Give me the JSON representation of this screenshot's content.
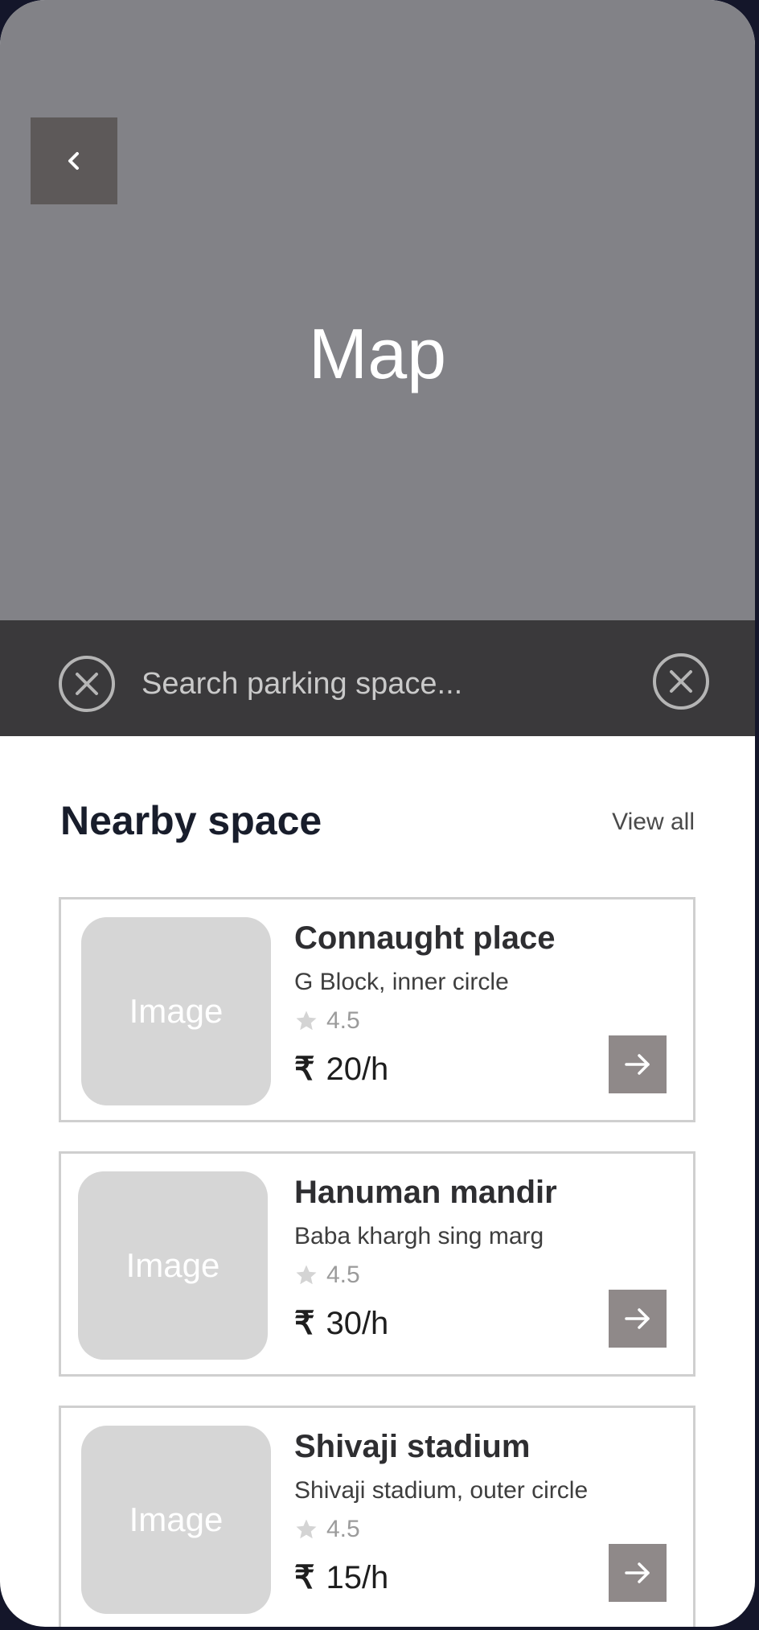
{
  "map": {
    "label": "Map",
    "back_icon": "chevron-left-icon"
  },
  "search": {
    "placeholder": "Search parking space...",
    "left_icon": "close-circle-icon",
    "right_icon": "close-circle-icon"
  },
  "nearby": {
    "title": "Nearby space",
    "view_all_label": "View all",
    "items": [
      {
        "image_label": "Image",
        "name": "Connaught place",
        "address": "G Block, inner circle",
        "rating": "4.5",
        "currency": "₹",
        "price": "20/h"
      },
      {
        "image_label": "Image",
        "name": "Hanuman mandir",
        "address": "Baba khargh sing marg",
        "rating": "4.5",
        "currency": "₹",
        "price": "30/h"
      },
      {
        "image_label": "Image",
        "name": "Shivaji stadium",
        "address": "Shivaji stadium, outer circle",
        "rating": "4.5",
        "currency": "₹",
        "price": "15/h"
      }
    ]
  },
  "colors": {
    "map_background": "#828287",
    "search_bar": "#3a393b",
    "back_button": "#5d5959",
    "arrow_button": "#8f8989",
    "image_placeholder": "#d6d6d6"
  }
}
